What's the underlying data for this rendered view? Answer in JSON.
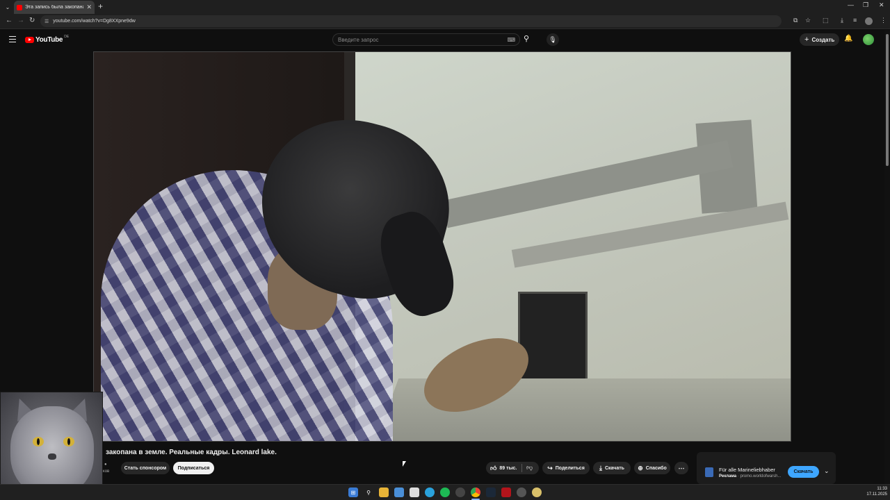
{
  "browser": {
    "tab_title": "Эта запись была закопана в зе",
    "tab_close": "✕",
    "new_tab": "+",
    "url": "youtube.com/watch?v=Dg8XXpne9dw",
    "window_controls": [
      "—",
      "❐",
      "✕"
    ]
  },
  "youtube": {
    "logo_text": "YouTube",
    "region": "DE",
    "search_placeholder": "Введите запрос",
    "create_label": "Создать"
  },
  "video": {
    "title": "закопана в земле. Реальные кадры. Leonard lake.",
    "channel_subs_fragment": "ков",
    "sponsor_label": "Стать спонсором",
    "subscribe_label": "Подписаться",
    "likes": "89 тыс.",
    "share_label": "Поделиться",
    "download_label": "Скачать",
    "thanks_label": "Спасибо",
    "more_label": "⋯"
  },
  "ad": {
    "title": "Für alle Marineliebhaber",
    "tag": "Реклама",
    "source": "promo.worldofwarsh...",
    "button": "Скачать"
  },
  "taskbar": {
    "apps": [
      "windows-start",
      "search",
      "file-explorer",
      "remote-desktop",
      "notepad",
      "telegram",
      "spotify",
      "obs",
      "chrome",
      "steam",
      "app-red",
      "app-circle",
      "app-yellow"
    ],
    "time": "11:33",
    "date": "17.11.2025"
  },
  "colors": {
    "background": "#0f0f0f",
    "accent_red": "#ff0000",
    "ad_button": "#3ea6ff"
  }
}
